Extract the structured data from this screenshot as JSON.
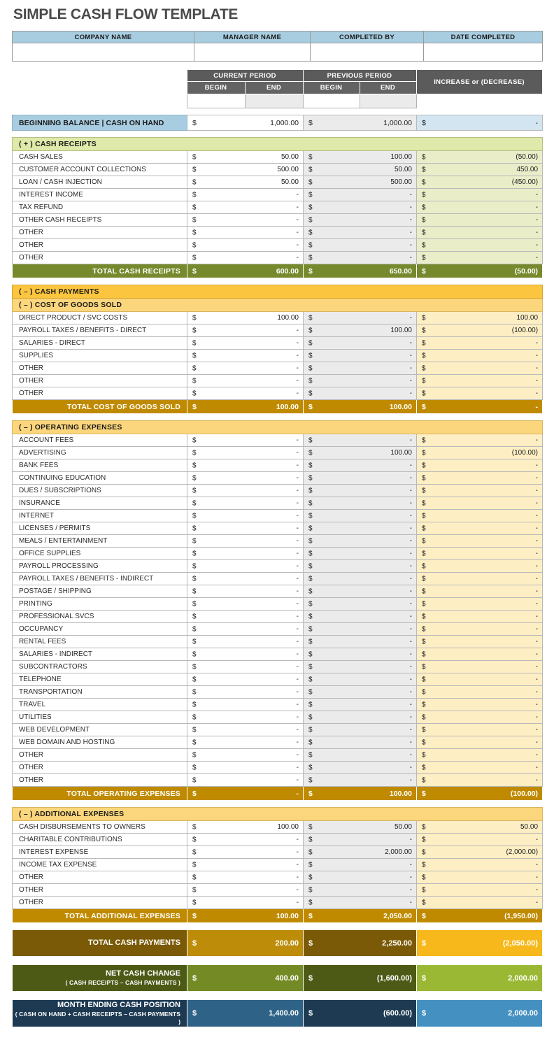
{
  "title": "SIMPLE CASH FLOW TEMPLATE",
  "info": {
    "headers": [
      "COMPANY NAME",
      "MANAGER NAME",
      "COMPLETED BY",
      "DATE COMPLETED"
    ],
    "values": [
      "",
      "",
      "",
      ""
    ]
  },
  "period_header": {
    "current_period": "CURRENT PERIOD",
    "previous_period": "PREVIOUS PERIOD",
    "increase_decrease": "INCREASE or (DECREASE)",
    "begin": "BEGIN",
    "end": "END",
    "inputs": [
      "",
      "",
      "",
      ""
    ]
  },
  "colors": {
    "header_blue": "#a8cde0",
    "dark_gray": "#5b5b5b",
    "green_banner": "#dfe9a9",
    "green_total": "#76892c",
    "gold_banner": "#fcc53f",
    "gold_banner_light": "#fcd67c",
    "gold_total": "#c08a00",
    "payments_accent": "#f6b81a",
    "net_accent": "#9ab833",
    "position_accent": "#4490c0"
  },
  "beginning_balance": {
    "label": "BEGINNING BALANCE | CASH ON HAND",
    "current": "1,000.00",
    "previous": "1,000.00",
    "increase": "-"
  },
  "sections": [
    {
      "id": "cash-receipts",
      "banner": "( + )  CASH RECEIPTS",
      "banner_style": "banner-green",
      "inc_style": "inc-green",
      "rows": [
        {
          "label": "CASH SALES",
          "current": "50.00",
          "previous": "100.00",
          "increase": "(50.00)"
        },
        {
          "label": "CUSTOMER ACCOUNT COLLECTIONS",
          "current": "500.00",
          "previous": "50.00",
          "increase": "450.00"
        },
        {
          "label": "LOAN / CASH INJECTION",
          "current": "50.00",
          "previous": "500.00",
          "increase": "(450.00)"
        },
        {
          "label": "INTEREST INCOME",
          "current": "-",
          "previous": "-",
          "increase": "-"
        },
        {
          "label": "TAX REFUND",
          "current": "-",
          "previous": "-",
          "increase": "-"
        },
        {
          "label": "OTHER CASH RECEIPTS",
          "current": "-",
          "previous": "-",
          "increase": "-"
        },
        {
          "label": "OTHER",
          "current": "-",
          "previous": "-",
          "increase": "-"
        },
        {
          "label": "OTHER",
          "current": "-",
          "previous": "-",
          "increase": "-"
        },
        {
          "label": "OTHER",
          "current": "-",
          "previous": "-",
          "increase": "-"
        }
      ],
      "total": {
        "label": "TOTAL CASH RECEIPTS",
        "current": "600.00",
        "previous": "650.00",
        "increase": "(50.00)",
        "style": "tot-green"
      }
    },
    {
      "id": "cost-of-goods-sold",
      "banner": "( – )  CASH PAYMENTS",
      "banner_style": "banner-gold",
      "banner2": "( – )  COST OF GOODS SOLD",
      "banner2_style": "banner-gold2",
      "inc_style": "inc-yellow",
      "rows": [
        {
          "label": "DIRECT PRODUCT / SVC COSTS",
          "current": "100.00",
          "previous": "-",
          "increase": "100.00"
        },
        {
          "label": "PAYROLL TAXES / BENEFITS - DIRECT",
          "current": "-",
          "previous": "100.00",
          "increase": "(100.00)"
        },
        {
          "label": "SALARIES - DIRECT",
          "current": "-",
          "previous": "-",
          "increase": "-"
        },
        {
          "label": "SUPPLIES",
          "current": "-",
          "previous": "-",
          "increase": "-"
        },
        {
          "label": "OTHER",
          "current": "-",
          "previous": "-",
          "increase": "-"
        },
        {
          "label": "OTHER",
          "current": "-",
          "previous": "-",
          "increase": "-"
        },
        {
          "label": "OTHER",
          "current": "-",
          "previous": "-",
          "increase": "-"
        }
      ],
      "total": {
        "label": "TOTAL COST OF GOODS SOLD",
        "current": "100.00",
        "previous": "100.00",
        "increase": "-",
        "style": "tot-gold"
      }
    },
    {
      "id": "operating-expenses",
      "banner": "( – )  OPERATING EXPENSES",
      "banner_style": "banner-gold2",
      "inc_style": "inc-yellow",
      "rows": [
        {
          "label": "ACCOUNT FEES",
          "current": "-",
          "previous": "-",
          "increase": "-"
        },
        {
          "label": "ADVERTISING",
          "current": "-",
          "previous": "100.00",
          "increase": "(100.00)"
        },
        {
          "label": "BANK FEES",
          "current": "-",
          "previous": "-",
          "increase": "-"
        },
        {
          "label": "CONTINUING EDUCATION",
          "current": "-",
          "previous": "-",
          "increase": "-"
        },
        {
          "label": "DUES / SUBSCRIPTIONS",
          "current": "-",
          "previous": "-",
          "increase": "-"
        },
        {
          "label": "INSURANCE",
          "current": "-",
          "previous": "-",
          "increase": "-"
        },
        {
          "label": "INTERNET",
          "current": "-",
          "previous": "-",
          "increase": "-"
        },
        {
          "label": "LICENSES / PERMITS",
          "current": "-",
          "previous": "-",
          "increase": "-"
        },
        {
          "label": "MEALS / ENTERTAINMENT",
          "current": "-",
          "previous": "-",
          "increase": "-"
        },
        {
          "label": "OFFICE SUPPLIES",
          "current": "-",
          "previous": "-",
          "increase": "-"
        },
        {
          "label": "PAYROLL PROCESSING",
          "current": "-",
          "previous": "-",
          "increase": "-"
        },
        {
          "label": "PAYROLL TAXES / BENEFITS - INDIRECT",
          "current": "-",
          "previous": "-",
          "increase": "-"
        },
        {
          "label": "POSTAGE / SHIPPING",
          "current": "-",
          "previous": "-",
          "increase": "-"
        },
        {
          "label": "PRINTING",
          "current": "-",
          "previous": "-",
          "increase": "-"
        },
        {
          "label": "PROFESSIONAL SVCS",
          "current": "-",
          "previous": "-",
          "increase": "-"
        },
        {
          "label": "OCCUPANCY",
          "current": "-",
          "previous": "-",
          "increase": "-"
        },
        {
          "label": "RENTAL FEES",
          "current": "-",
          "previous": "-",
          "increase": "-"
        },
        {
          "label": "SALARIES - INDIRECT",
          "current": "-",
          "previous": "-",
          "increase": "-"
        },
        {
          "label": "SUBCONTRACTORS",
          "current": "-",
          "previous": "-",
          "increase": "-"
        },
        {
          "label": "TELEPHONE",
          "current": "-",
          "previous": "-",
          "increase": "-"
        },
        {
          "label": "TRANSPORTATION",
          "current": "-",
          "previous": "-",
          "increase": "-"
        },
        {
          "label": "TRAVEL",
          "current": "-",
          "previous": "-",
          "increase": "-"
        },
        {
          "label": "UTILITIES",
          "current": "-",
          "previous": "-",
          "increase": "-"
        },
        {
          "label": "WEB DEVELOPMENT",
          "current": "-",
          "previous": "-",
          "increase": "-"
        },
        {
          "label": "WEB DOMAIN AND HOSTING",
          "current": "-",
          "previous": "-",
          "increase": "-"
        },
        {
          "label": "OTHER",
          "current": "-",
          "previous": "-",
          "increase": "-"
        },
        {
          "label": "OTHER",
          "current": "-",
          "previous": "-",
          "increase": "-"
        },
        {
          "label": "OTHER",
          "current": "-",
          "previous": "-",
          "increase": "-"
        }
      ],
      "total": {
        "label": "TOTAL OPERATING EXPENSES",
        "current": "-",
        "previous": "100.00",
        "increase": "(100.00)",
        "style": "tot-gold"
      }
    },
    {
      "id": "additional-expenses",
      "banner": "( – )  ADDITIONAL EXPENSES",
      "banner_style": "banner-gold2",
      "inc_style": "inc-yellow",
      "rows": [
        {
          "label": "CASH DISBURSEMENTS TO OWNERS",
          "current": "100.00",
          "previous": "50.00",
          "increase": "50.00"
        },
        {
          "label": "CHARITABLE CONTRIBUTIONS",
          "current": "-",
          "previous": "-",
          "increase": "-"
        },
        {
          "label": "INTEREST EXPENSE",
          "current": "-",
          "previous": "2,000.00",
          "increase": "(2,000.00)"
        },
        {
          "label": "INCOME TAX EXPENSE",
          "current": "-",
          "previous": "-",
          "increase": "-"
        },
        {
          "label": "OTHER",
          "current": "-",
          "previous": "-",
          "increase": "-"
        },
        {
          "label": "OTHER",
          "current": "-",
          "previous": "-",
          "increase": "-"
        },
        {
          "label": "OTHER",
          "current": "-",
          "previous": "-",
          "increase": "-"
        }
      ],
      "total": {
        "label": "TOTAL ADDITIONAL EXPENSES",
        "current": "100.00",
        "previous": "2,050.00",
        "increase": "(1,950.00)",
        "style": "tot-gold"
      }
    }
  ],
  "summaries": [
    {
      "id": "total-cash-payments",
      "label": "TOTAL CASH PAYMENTS",
      "sublabel": "",
      "current": "200.00",
      "previous": "2,250.00",
      "increase": "(2,050.00)",
      "style": "pay"
    },
    {
      "id": "net-cash-change",
      "label": "NET CASH CHANGE",
      "sublabel": "( CASH RECEIPTS – CASH PAYMENTS )",
      "current": "400.00",
      "previous": "(1,600.00)",
      "increase": "2,000.00",
      "style": "net"
    },
    {
      "id": "month-ending-cash-position",
      "label": "MONTH ENDING CASH POSITION",
      "sublabel": "( CASH ON HAND + CASH RECEIPTS – CASH PAYMENTS )",
      "current": "1,400.00",
      "previous": "(600.00)",
      "increase": "2,000.00",
      "style": "pos"
    }
  ],
  "currency_symbol": "$"
}
